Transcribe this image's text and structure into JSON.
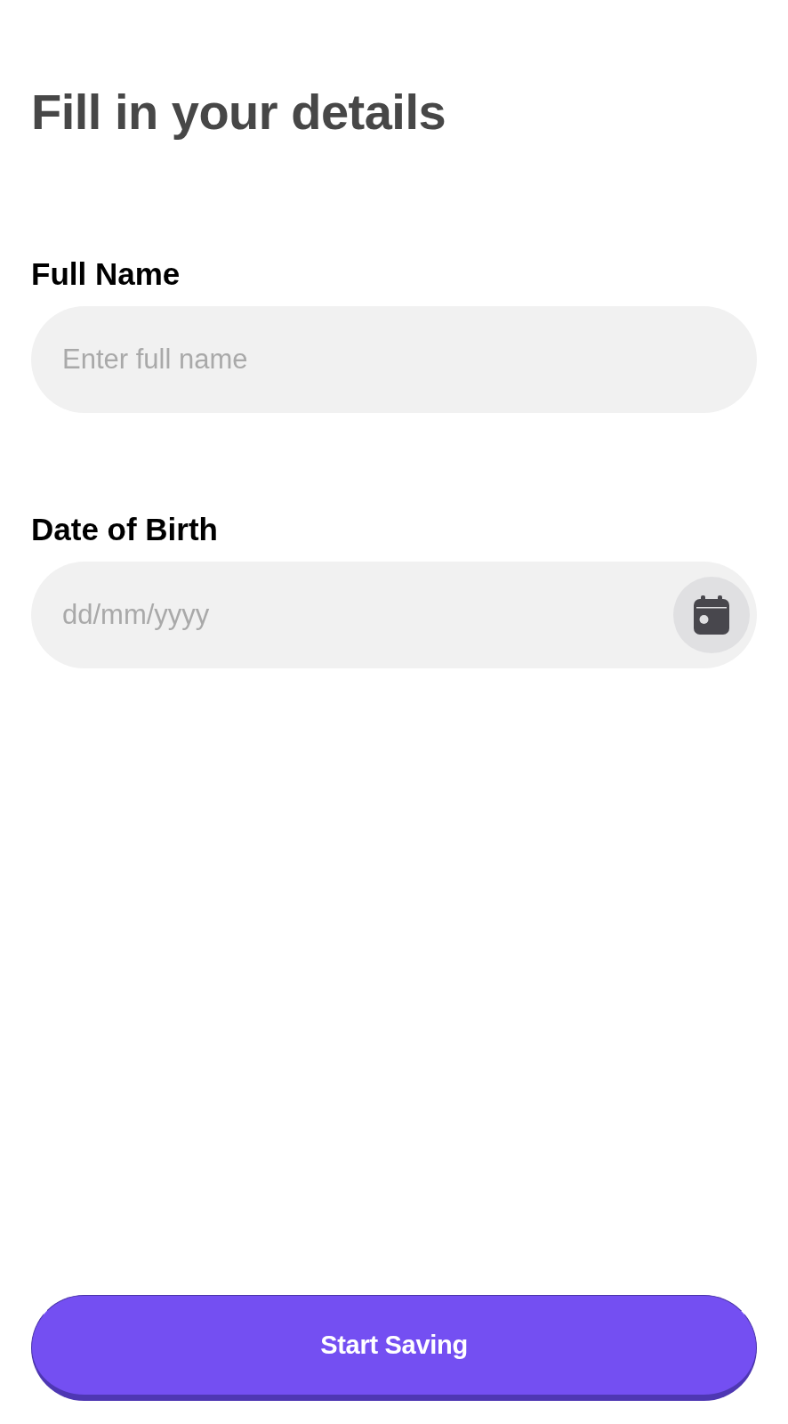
{
  "title": "Fill in your details",
  "fields": [
    {
      "kind": "text",
      "label": "Full Name",
      "placeholder": "Enter full name"
    },
    {
      "kind": "date",
      "label": "Date of Birth",
      "placeholder": "dd/mm/yyyy"
    }
  ],
  "button": {
    "label": "Start Saving"
  }
}
